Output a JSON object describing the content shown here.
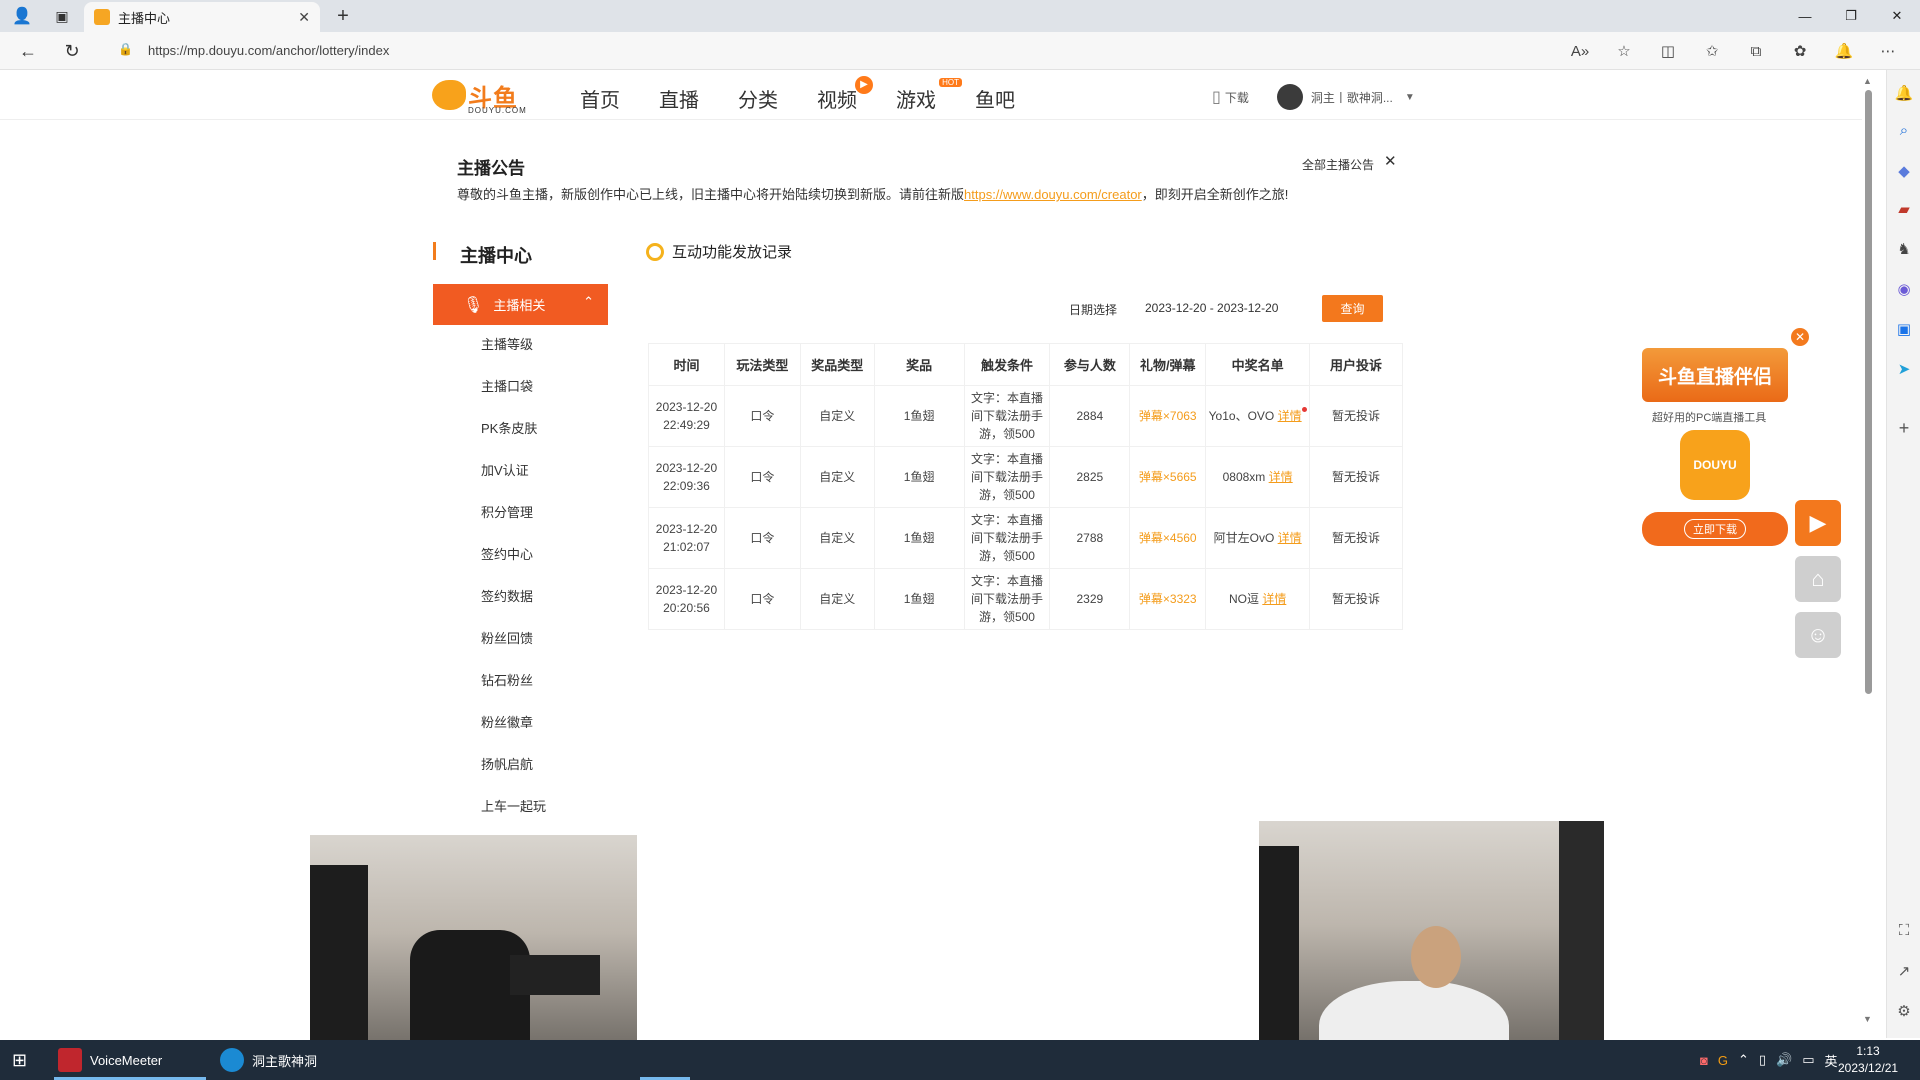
{
  "browser": {
    "tab_title": "主播中心",
    "url": "https://mp.douyu.com/anchor/lottery/index",
    "window_controls": [
      "—",
      "❐",
      "✕"
    ]
  },
  "header": {
    "logo_cn": "斗鱼",
    "logo_en": "DOUYU.COM",
    "nav": [
      "首页",
      "直播",
      "分类",
      "视频",
      "游戏",
      "鱼吧"
    ],
    "hot_badge": "HOT",
    "download": "下载",
    "username": "洞主丨歌神洞..."
  },
  "notice": {
    "title": "主播公告",
    "all_label": "全部主播公告",
    "text_before": "尊敬的斗鱼主播，新版创作中心已上线，旧主播中心将开始陆续切换到新版。请前往新版",
    "link": "https://www.douyu.com/creator",
    "text_after": "，即刻开启全新创作之旅!"
  },
  "sidebar": {
    "title": "主播中心",
    "active": "主播相关",
    "items": [
      "主播等级",
      "主播口袋",
      "PK条皮肤",
      "加V认证",
      "积分管理",
      "签约中心",
      "签约数据",
      "粉丝回馈",
      "钻石粉丝",
      "粉丝徽章",
      "扬帆启航",
      "上车一起玩"
    ]
  },
  "content": {
    "section_title": "互动功能发放记录",
    "date_label": "日期选择",
    "date_range": "2023-12-20 - 2023-12-20",
    "query_button": "查询",
    "columns": [
      "时间",
      "玩法类型",
      "奖品类型",
      "奖品",
      "触发条件",
      "参与人数",
      "礼物/弹幕",
      "中奖名单",
      "用户投诉"
    ],
    "detail_label": "详情",
    "rows": [
      {
        "date": "2023-12-20",
        "time": "22:49:29",
        "play": "口令",
        "prize_type": "自定义",
        "prize": "1鱼翅",
        "cond1": "文字：本直播",
        "cond2": "间下载法册手",
        "cond3": "游，领500",
        "count": "2884",
        "gift": "弹幕×7063",
        "winner": "Yo1o、OVO"
      },
      {
        "date": "2023-12-20",
        "time": "22:09:36",
        "play": "口令",
        "prize_type": "自定义",
        "prize": "1鱼翅",
        "cond1": "文字：本直播",
        "cond2": "间下载法册手",
        "cond3": "游，领500",
        "count": "2825",
        "gift": "弹幕×5665",
        "winner": "0808xm"
      },
      {
        "date": "2023-12-20",
        "time": "21:02:07",
        "play": "口令",
        "prize_type": "自定义",
        "prize": "1鱼翅",
        "cond1": "文字：本直播",
        "cond2": "间下载法册手",
        "cond3": "游，领500",
        "count": "2788",
        "gift": "弹幕×4560",
        "winner": "阿甘左OvO"
      },
      {
        "date": "2023-12-20",
        "time": "20:20:56",
        "play": "口令",
        "prize_type": "自定义",
        "prize": "1鱼翅",
        "cond1": "文字：本直播",
        "cond2": "间下载法册手",
        "cond3": "游，领500",
        "count": "2329",
        "gift": "弹幕×3323",
        "winner": "NO逗"
      }
    ],
    "complaint": "暂无投诉"
  },
  "promo": {
    "banner": "斗鱼直播伴侣",
    "subtitle": "超好用的PC端直播工具",
    "app_label": "DOUYU",
    "download_button": "立即下载"
  },
  "taskbar": {
    "app1": "VoiceMeeter",
    "app2": "洞主歌神洞",
    "ime": "英",
    "time": "1:13",
    "date": "2023/12/21"
  },
  "colors": {
    "accent": "#f15b22",
    "link": "#f49c1b",
    "query": "#f3781d"
  }
}
